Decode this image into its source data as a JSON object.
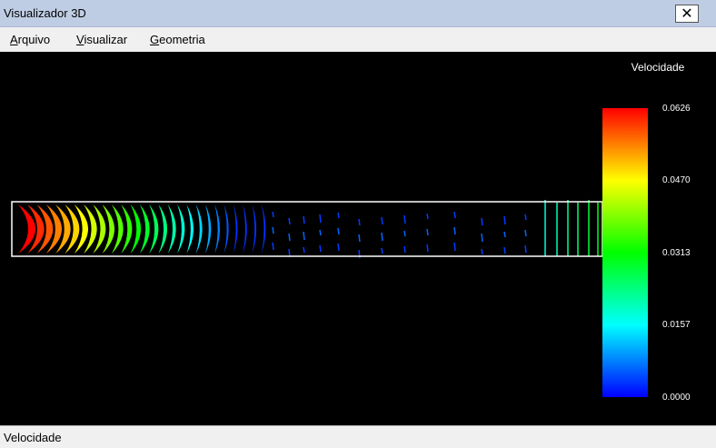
{
  "window": {
    "title": "Visualizador 3D",
    "close_glyph": "✕"
  },
  "menu": [
    {
      "accel": "A",
      "rest": "rquivo"
    },
    {
      "accel": "V",
      "rest": "isualizar"
    },
    {
      "accel": "G",
      "rest": "eometria"
    }
  ],
  "legend": {
    "title": "Velocidade",
    "ticks": [
      "0.0626",
      "0.0470",
      "0.0313",
      "0.0157",
      "0.0000"
    ],
    "min": 0.0,
    "max": 0.0626,
    "colormap": [
      "#ff0000",
      "#ffff00",
      "#00ff00",
      "#00ffff",
      "#0000ff"
    ]
  },
  "status": {
    "text": "Velocidade"
  },
  "colors": {
    "background": "#000000",
    "domain_outline": "#ffffff"
  }
}
